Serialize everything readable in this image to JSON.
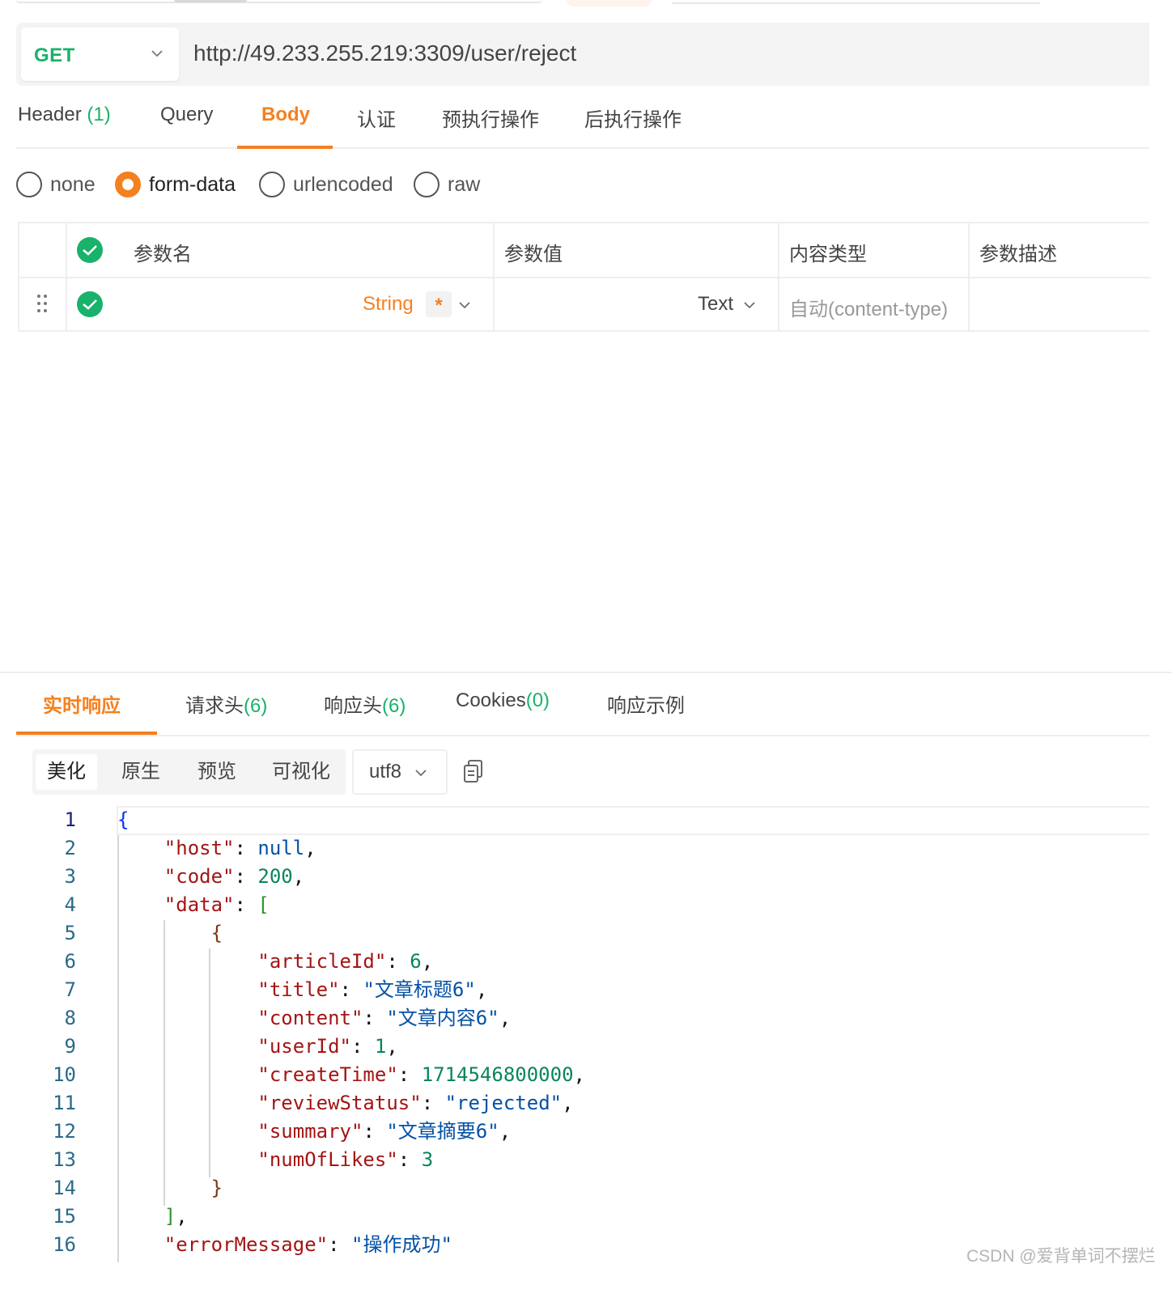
{
  "request": {
    "method": "GET",
    "url": "http://49.233.255.219:3309/user/reject"
  },
  "request_tabs": [
    {
      "label": "Header",
      "count": "(1)"
    },
    {
      "label": "Query",
      "count": ""
    },
    {
      "label": "Body",
      "count": "",
      "active": true
    },
    {
      "label": "认证",
      "count": ""
    },
    {
      "label": "预执行操作",
      "count": ""
    },
    {
      "label": "后执行操作",
      "count": ""
    }
  ],
  "body_types": [
    {
      "label": "none",
      "selected": false
    },
    {
      "label": "form-data",
      "selected": true
    },
    {
      "label": "urlencoded",
      "selected": false
    },
    {
      "label": "raw",
      "selected": false
    }
  ],
  "params_table": {
    "headers": [
      "参数名",
      "参数值",
      "内容类型",
      "参数描述"
    ],
    "row": {
      "type": "String",
      "required_mark": "*",
      "value_type": "Text",
      "content_type_placeholder": "自动(content-type)"
    }
  },
  "response_tabs": [
    {
      "label": "实时响应",
      "count": "",
      "active": true
    },
    {
      "label": "请求头",
      "count": "(6)"
    },
    {
      "label": "响应头",
      "count": "(6)"
    },
    {
      "label": "Cookies",
      "count": "(0)"
    },
    {
      "label": "响应示例",
      "count": ""
    }
  ],
  "view_modes": [
    {
      "label": "美化",
      "active": true
    },
    {
      "label": "原生",
      "active": false
    },
    {
      "label": "预览",
      "active": false
    },
    {
      "label": "可视化",
      "active": false
    }
  ],
  "encoding": "utf8",
  "response_body": {
    "host_key": "\"host\"",
    "host_val": "null",
    "code_key": "\"code\"",
    "code_val": "200",
    "data_key": "\"data\"",
    "articleId_key": "\"articleId\"",
    "articleId_val": "6",
    "title_key": "\"title\"",
    "title_val": "\"文章标题6\"",
    "content_key": "\"content\"",
    "content_val": "\"文章内容6\"",
    "userId_key": "\"userId\"",
    "userId_val": "1",
    "createTime_key": "\"createTime\"",
    "createTime_val": "1714546800000",
    "reviewStatus_key": "\"reviewStatus\"",
    "reviewStatus_val": "\"rejected\"",
    "summary_key": "\"summary\"",
    "summary_val": "\"文章摘要6\"",
    "numOfLikes_key": "\"numOfLikes\"",
    "numOfLikes_val": "3",
    "errorMessage_key": "\"errorMessage\"",
    "errorMessage_val": "\"操作成功\""
  },
  "line_numbers": [
    "1",
    "2",
    "3",
    "4",
    "5",
    "6",
    "7",
    "8",
    "9",
    "10",
    "11",
    "12",
    "13",
    "14",
    "15",
    "16"
  ],
  "watermark": "CSDN @爱背单词不摆烂",
  "colors": {
    "accent": "#f5801f",
    "success": "#18b26a",
    "json_key": "#a31515",
    "json_number": "#098658",
    "json_string": "#0451a5"
  }
}
